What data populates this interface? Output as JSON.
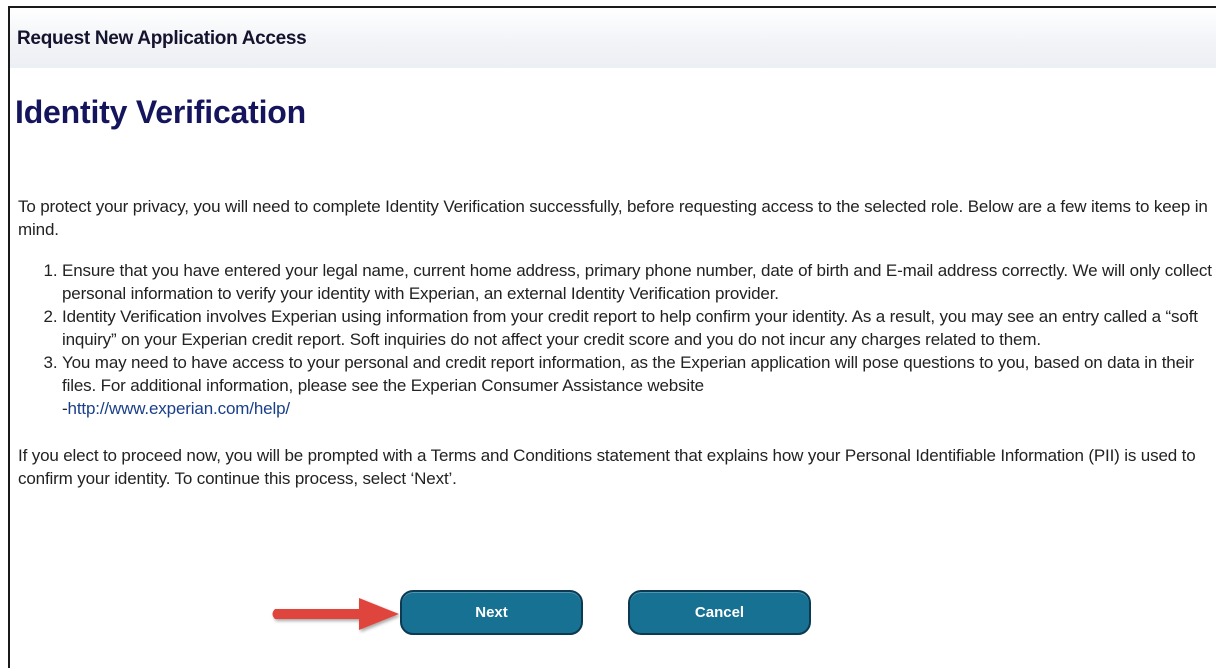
{
  "header": {
    "title": "Request New Application Access"
  },
  "page": {
    "title": "Identity Verification"
  },
  "intro": "To protect your privacy, you will need to complete Identity Verification successfully, before requesting access to the selected role. Below are a few items to keep in mind.",
  "items": [
    {
      "text": "Ensure that you have entered your legal name, current home address, primary phone number, date of birth and E-mail address correctly. We will only collect personal information to verify your identity with Experian, an external Identity Verification provider."
    },
    {
      "text": "Identity Verification involves Experian using information from your credit report to help confirm your identity. As a result, you may see an entry called a “soft inquiry” on your Experian credit report. Soft inquiries do not affect your credit score and you do not incur any charges related to them."
    },
    {
      "text": "You may need to have access to your personal and credit report information, as the Experian application will pose questions to you, based on data in their files. For additional information, please see the Experian Consumer Assistance website",
      "link_prefix": "-",
      "link_text": "http://www.experian.com/help/"
    }
  ],
  "closing": "If you elect to proceed now, you will be prompted with a Terms and Conditions statement that explains how your Personal Identifiable Information (PII) is used to confirm your identity. To continue this process, select ‘Next’.",
  "buttons": {
    "next": "Next",
    "cancel": "Cancel"
  },
  "colors": {
    "button": "#177193",
    "title": "#15155e",
    "arrow": "#e0453c"
  }
}
